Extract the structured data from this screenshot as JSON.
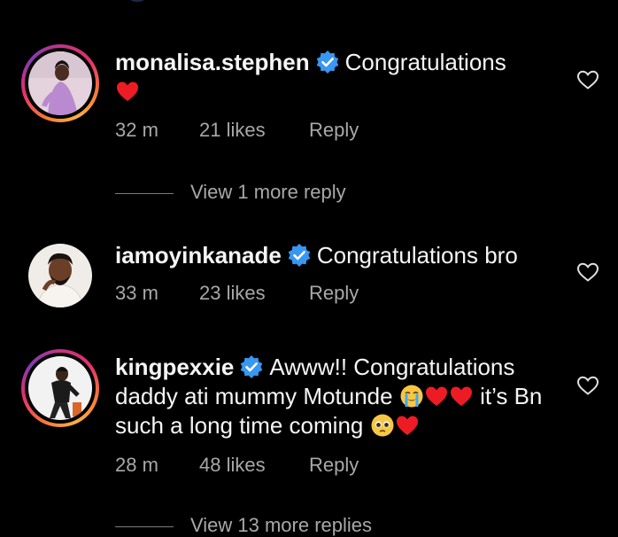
{
  "comments": [
    {
      "username": "monalisa.stephen",
      "text": "Congratulations",
      "time": "32 m",
      "likes": "21 likes",
      "reply_label": "Reply",
      "view_replies": "View 1 more reply"
    },
    {
      "username": "iamoyinkanade",
      "text": "Congratulations bro",
      "time": "33 m",
      "likes": "23 likes",
      "reply_label": "Reply"
    },
    {
      "username": "kingpexxie",
      "text_part1": "Awww!! Congratulations daddy ati mummy Motunde",
      "text_part2": "it’s Bn such a long time coming",
      "time": "28 m",
      "likes": "48 likes",
      "reply_label": "Reply",
      "view_replies": "View 13 more replies"
    }
  ],
  "icons": {
    "verified": "verified-badge-icon",
    "like": "heart-outline-icon",
    "emoji_heart": "red-heart-emoji",
    "emoji_crying": "loudly-crying-face-emoji",
    "emoji_pleading": "pleading-face-emoji"
  },
  "colors": {
    "background": "#000000",
    "text_primary": "#f5f5f5",
    "text_secondary": "#a8a8a8",
    "verified_blue": "#3897f0",
    "heart_red": "#ed1c24",
    "story_ring": "#e1306c"
  }
}
